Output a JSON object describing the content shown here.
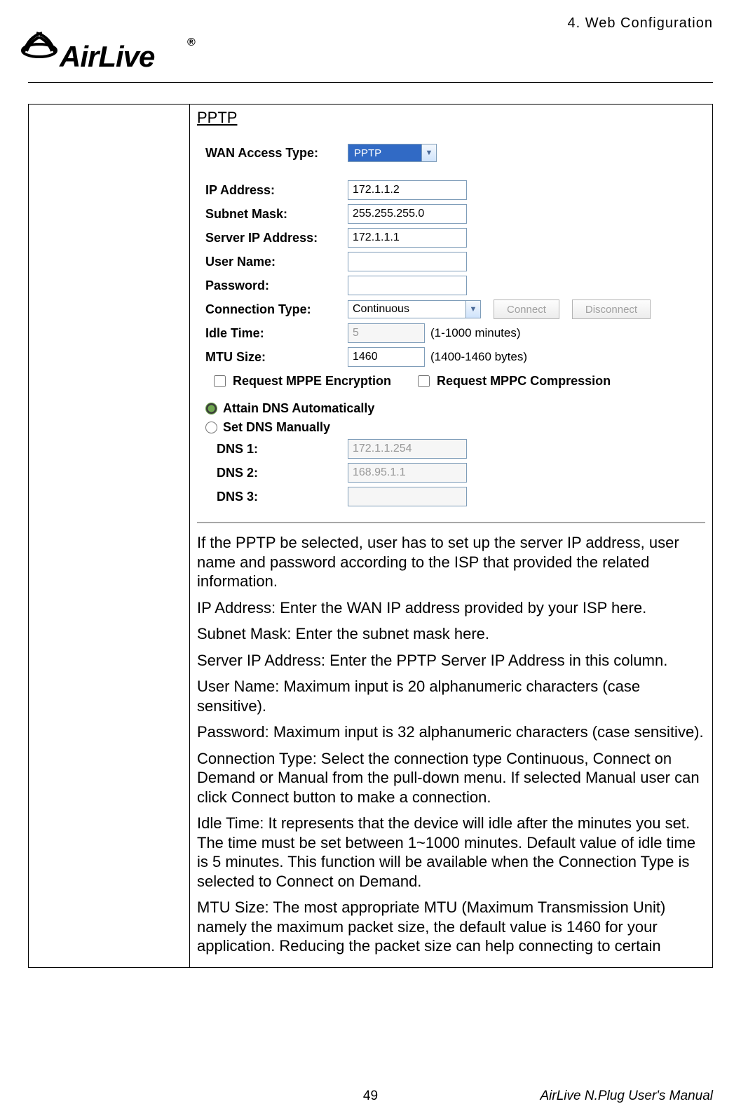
{
  "header": {
    "chapter": "4.  Web  Configuration",
    "brand_main": "AirLive",
    "brand_sup": "®"
  },
  "section": {
    "title": "PPTP"
  },
  "form": {
    "wan_access_type": {
      "label": "WAN Access Type:",
      "value": "PPTP"
    },
    "ip_address": {
      "label": "IP Address:",
      "value": "172.1.1.2"
    },
    "subnet_mask": {
      "label": "Subnet Mask:",
      "value": "255.255.255.0"
    },
    "server_ip": {
      "label": "Server IP Address:",
      "value": "172.1.1.1"
    },
    "user_name": {
      "label": "User Name:",
      "value": ""
    },
    "password": {
      "label": "Password:",
      "value": ""
    },
    "connection_type": {
      "label": "Connection Type:",
      "value": "Continuous",
      "connect_btn": "Connect",
      "disconnect_btn": "Disconnect"
    },
    "idle_time": {
      "label": "Idle Time:",
      "value": "5",
      "hint": "(1-1000 minutes)"
    },
    "mtu_size": {
      "label": "MTU Size:",
      "value": "1460",
      "hint": "(1400-1460 bytes)"
    },
    "mppe_encryption": "Request MPPE Encryption",
    "mppc_compression": "Request MPPC Compression",
    "dns_auto": "Attain DNS Automatically",
    "dns_manual": "Set DNS Manually",
    "dns1": {
      "label": "DNS 1:",
      "value": "172.1.1.254"
    },
    "dns2": {
      "label": "DNS 2:",
      "value": "168.95.1.1"
    },
    "dns3": {
      "label": "DNS 3:",
      "value": ""
    }
  },
  "desc": {
    "p1": "If the PPTP be selected, user has to set up the server IP address, user name and password according to the ISP that provided the related information.",
    "p2": "IP Address: Enter the WAN IP address provided by your ISP here.",
    "p3": "Subnet Mask: Enter the subnet mask here.",
    "p4": "Server IP Address: Enter the PPTP Server IP Address in this column.",
    "p5": "User Name: Maximum input is 20 alphanumeric characters (case sensitive).",
    "p6": "Password: Maximum input is 32 alphanumeric characters (case sensitive).",
    "p7": "Connection Type: Select the connection type Continuous, Connect on Demand or Manual from the pull-down menu. If selected Manual user can click Connect button to make a connection.",
    "p8": "Idle Time: It represents that the device will idle after the minutes you set. The time must be set between 1~1000 minutes. Default value of idle time is 5 minutes. This function will be available when the Connection Type is selected to Connect on Demand.",
    "p9": "MTU Size: The most appropriate MTU (Maximum Transmission Unit) namely the maximum packet size, the default value is 1460 for your application. Reducing the packet size can help connecting to certain"
  },
  "footer": {
    "page": "49",
    "manual": "AirLive N.Plug User's Manual"
  }
}
